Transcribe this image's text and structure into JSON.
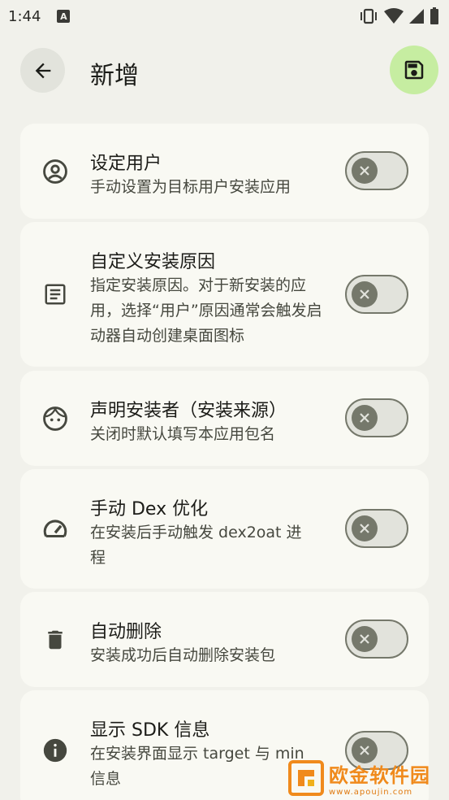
{
  "status_bar": {
    "time": "1:44",
    "badge": "A"
  },
  "app_bar": {
    "title": "新增"
  },
  "settings": [
    {
      "title": "设定用户",
      "description": "手动设置为目标用户安装应用",
      "enabled": false,
      "icon": "account-circle-icon"
    },
    {
      "title": "自定义安装原因",
      "description": "指定安装原因。对于新安装的应用，选择“用户”原因通常会触发启动器自动创建桌面图标",
      "enabled": false,
      "icon": "article-icon"
    },
    {
      "title": "声明安装者（安装来源）",
      "description": "关闭时默认填写本应用包名",
      "enabled": false,
      "icon": "face-icon"
    },
    {
      "title": "手动 Dex 优化",
      "description": "在安装后手动触发 dex2oat 进程",
      "enabled": false,
      "icon": "speed-icon"
    },
    {
      "title": "自动删除",
      "description": "安装成功后自动删除安装包",
      "enabled": false,
      "icon": "delete-icon"
    },
    {
      "title": "显示 SDK 信息",
      "description": "在安装界面显示 target 与 min 信息",
      "enabled": false,
      "icon": "info-icon"
    }
  ],
  "watermark": {
    "text": "欧金软件园",
    "url": "www.apoujin.com"
  },
  "colors": {
    "background": "#f1f1eb",
    "card": "#f9f9f3",
    "accent": "#c6eda1",
    "switch_off": "#75786b"
  }
}
